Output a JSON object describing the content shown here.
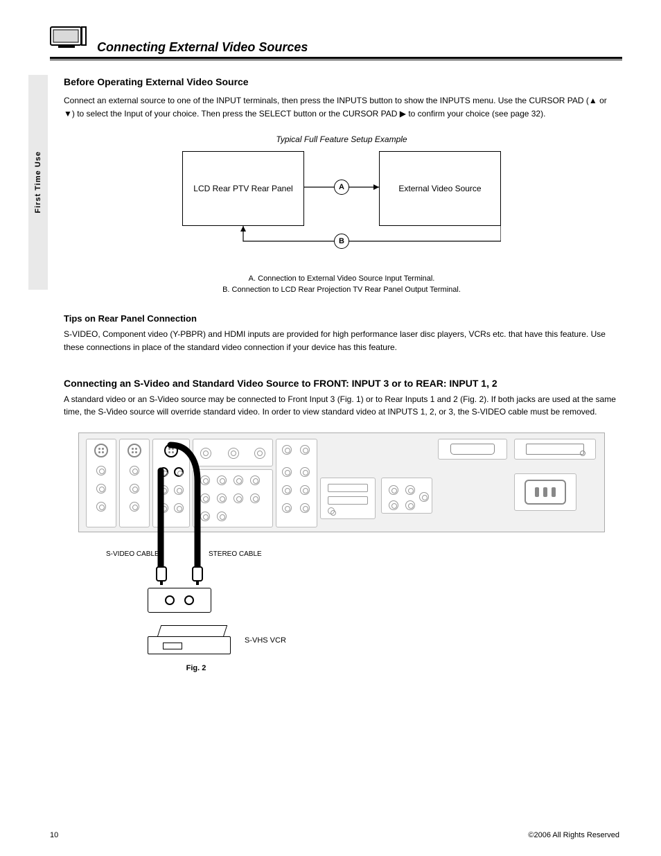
{
  "header": {
    "title": "Connecting External Video Sources"
  },
  "side_tab": "First Time Use",
  "before_connect": {
    "heading": "Before Operating External Video Source",
    "para": "Connect an external source to one of the INPUT terminals, then press the INPUTS button to show the INPUTS menu. Use the CURSOR PAD (▲ or ▼) to select the Input of your choice. Then press the SELECT button or the CURSOR PAD ▶ to confirm your choice (see page 32).",
    "example_caption": "Typical Full Feature Setup Example",
    "boxA": "LCD Rear PTV Rear Panel",
    "boxB": "External Video Source",
    "circleA": "A",
    "circleB": "B",
    "captionA": "A. Connection to External Video Source Input Terminal.",
    "captionB": "B. Connection to LCD Rear Projection TV Rear Panel Output Terminal."
  },
  "tips": {
    "heading": "Tips on Rear Panel Connection",
    "body": "S-VIDEO, Component video (Y-PBPR) and HDMI inputs are provided for high performance laser disc players, VCRs etc. that have this feature. Use these connections in place of the standard video connection if your device has this feature."
  },
  "svideo": {
    "heading": "Connecting an S-Video and Standard Video Source to FRONT: INPUT 3 or to REAR: INPUT 1, 2",
    "body": "A standard video or an S-Video source may be connected to Front Input 3 (Fig. 1) or to Rear Inputs 1 and 2 (Fig. 2). If both jacks are used at the same time, the S-Video source will override standard video. In order to view standard video at INPUTS 1, 2, or 3, the S-VIDEO cable must be removed."
  },
  "panel": {
    "svideo_cable_label": "S-VIDEO CABLE",
    "stereo_cable_label": "STEREO CABLE",
    "vcr_label": "S-VHS VCR",
    "fig": "Fig. 2"
  },
  "footer": {
    "page": "10",
    "rights": "©2006 All Rights Reserved"
  }
}
